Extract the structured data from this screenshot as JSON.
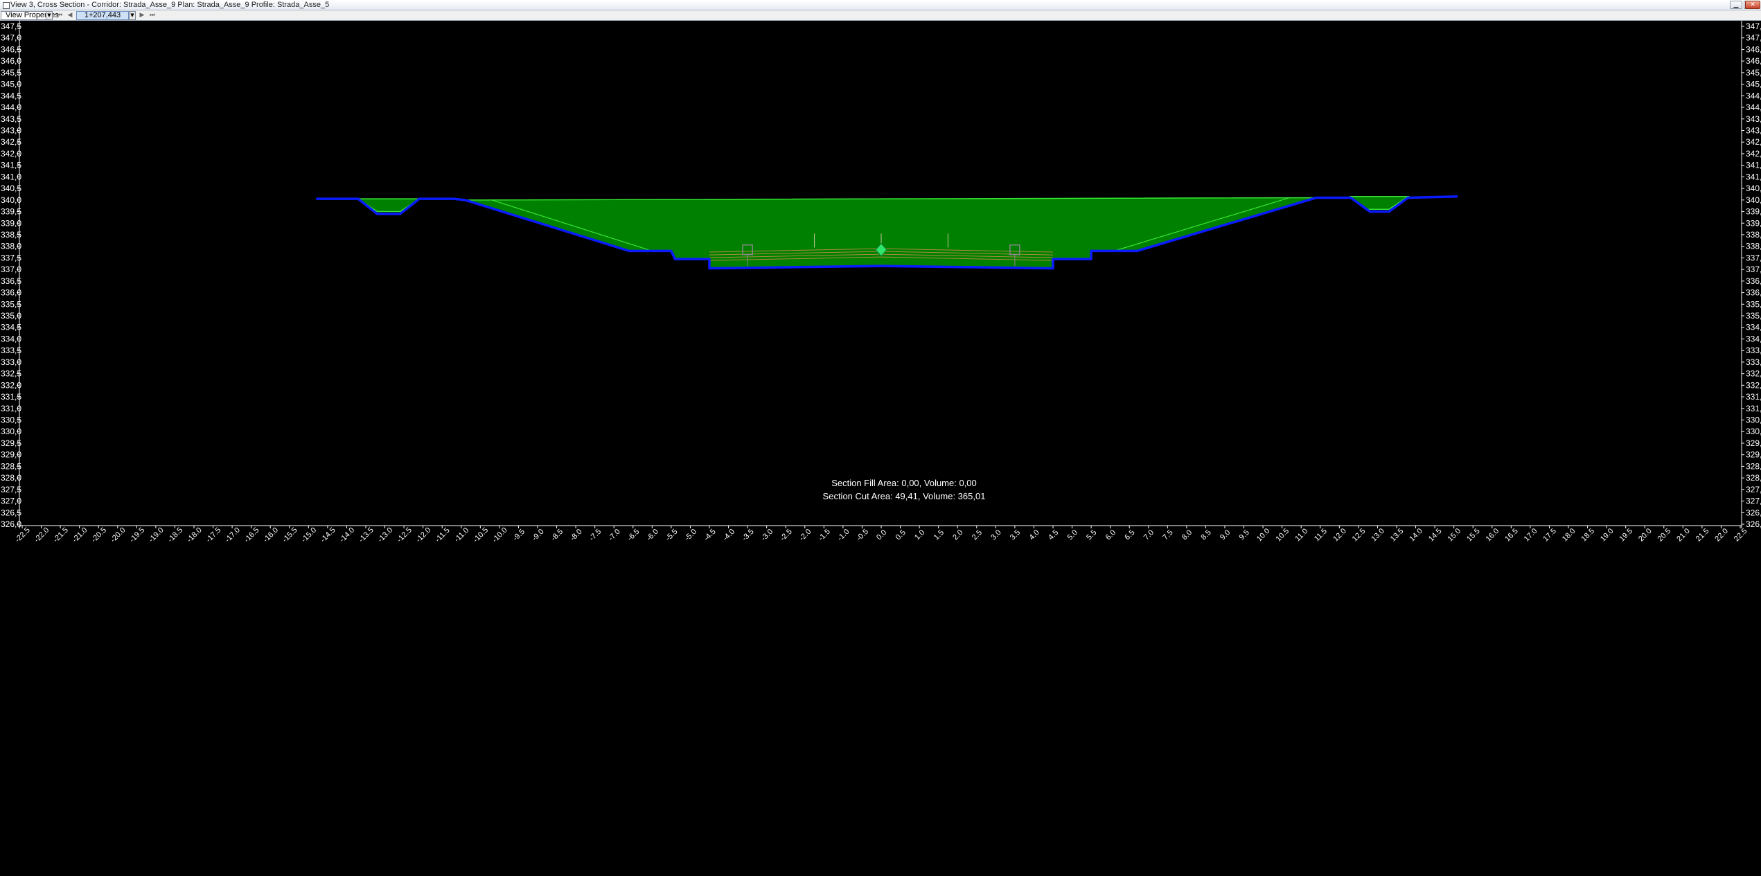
{
  "window": {
    "title": "View 3, Cross Section - Corridor: Strada_Asse_9 Plan: Strada_Asse_9 Profile: Strada_Asse_5",
    "buttons": {
      "minimize": "▁",
      "maximize": "☐",
      "close": "✕"
    }
  },
  "toolbar": {
    "view_properties_label": "View Properties",
    "station_value": "1+207,443",
    "icons": [
      "first-icon",
      "previous-icon",
      "next-icon",
      "last-icon",
      "chevron-down-icon"
    ]
  },
  "colors": {
    "background": "#000000",
    "cut_fill": "#008000",
    "outline_light": "#39e639",
    "ground_line": "#0a1cff",
    "pavement": "#b08a3a",
    "axis_text": "#ffffff"
  },
  "chart_data": {
    "type": "area",
    "title": "",
    "xlabel": "",
    "ylabel": "",
    "xlim": [
      -22.5,
      22.5
    ],
    "ylim": [
      326.0,
      347.5
    ],
    "x_ticks": [
      "-22.5",
      "-22.0",
      "-21.5",
      "-21.0",
      "-20.5",
      "-20.0",
      "-19.5",
      "-19.0",
      "-18.5",
      "-18.0",
      "-17.5",
      "-17.0",
      "-16.5",
      "-16.0",
      "-15.5",
      "-15.0",
      "-14.5",
      "-14.0",
      "-13.5",
      "-13.0",
      "-12.5",
      "-12.0",
      "-11.5",
      "-11.0",
      "-10.5",
      "-10.0",
      "-9.5",
      "-9.0",
      "-8.5",
      "-8.0",
      "-7.5",
      "-7.0",
      "-6.5",
      "-6.0",
      "-5.5",
      "-5.0",
      "-4.5",
      "-4.0",
      "-3.5",
      "-3.0",
      "-2.5",
      "-2.0",
      "-1.5",
      "-1.0",
      "-0.5",
      "0.0",
      "0.5",
      "1.0",
      "1.5",
      "2.0",
      "2.5",
      "3.0",
      "3.5",
      "4.0",
      "4.5",
      "5.0",
      "5.5",
      "6.0",
      "6.5",
      "7.0",
      "7.5",
      "8.0",
      "8.5",
      "9.0",
      "9.5",
      "10.0",
      "10.5",
      "11.0",
      "11.5",
      "12.0",
      "12.5",
      "13.0",
      "13.5",
      "14.0",
      "14.5",
      "15.0",
      "15.5",
      "16.0",
      "16.5",
      "17.0",
      "17.5",
      "18.0",
      "18.5",
      "19.0",
      "19.5",
      "20.0",
      "20.5",
      "21.0",
      "21.5",
      "22.0",
      "22.5"
    ],
    "y_ticks": [
      "347,5",
      "347,0",
      "346,5",
      "346,0",
      "345,5",
      "345,0",
      "344,5",
      "344,0",
      "343,5",
      "343,0",
      "342,5",
      "342,0",
      "341,5",
      "341,0",
      "340,5",
      "340,0",
      "339,5",
      "339,0",
      "338,5",
      "338,0",
      "337,5",
      "337,0",
      "336,5",
      "336,0",
      "335,5",
      "335,0",
      "334,5",
      "334,0",
      "333,5",
      "333,0",
      "332,5",
      "332,0",
      "331,5",
      "331,0",
      "330,5",
      "330,0",
      "329,5",
      "329,0",
      "328,5",
      "328,0",
      "327,5",
      "327,0",
      "326,5",
      "326,0"
    ],
    "ground_profile": [
      [
        -14.8,
        340.05
      ],
      [
        -13.7,
        340.05
      ],
      [
        -13.2,
        339.4
      ],
      [
        -12.6,
        339.4
      ],
      [
        -12.1,
        340.05
      ],
      [
        -11.2,
        340.05
      ],
      [
        -10.9,
        340.0
      ],
      [
        -6.6,
        337.8
      ],
      [
        -5.5,
        337.8
      ],
      [
        -5.4,
        337.45
      ],
      [
        -4.5,
        337.45
      ],
      [
        -4.5,
        337.05
      ],
      [
        0.0,
        337.15
      ],
      [
        4.5,
        337.05
      ],
      [
        4.5,
        337.45
      ],
      [
        5.5,
        337.45
      ],
      [
        5.5,
        337.8
      ],
      [
        6.7,
        337.8
      ],
      [
        11.4,
        340.1
      ],
      [
        12.3,
        340.1
      ],
      [
        12.8,
        339.5
      ],
      [
        13.3,
        339.5
      ],
      [
        13.8,
        340.1
      ],
      [
        15.1,
        340.15
      ]
    ],
    "cut_region_top": [
      [
        -10.9,
        340.0
      ],
      [
        11.4,
        340.1
      ]
    ],
    "ditches": [
      {
        "side": "left",
        "top_left": [
          -13.7,
          340.05
        ],
        "bottom": [
          -12.9,
          339.5
        ],
        "top_right": [
          -12.1,
          340.05
        ]
      },
      {
        "side": "right",
        "top_left": [
          12.3,
          340.15
        ],
        "bottom": [
          13.0,
          339.6
        ],
        "top_right": [
          13.8,
          340.15
        ]
      }
    ],
    "pavement_width": [
      -4.5,
      4.5
    ],
    "crown": [
      0.0,
      337.85
    ],
    "annotations": {
      "fill": "Section Fill Area: 0,00, Volume: 0,00",
      "cut": "Section Cut Area: 49,41, Volume: 365,01"
    },
    "grid": false,
    "legend": "none"
  }
}
